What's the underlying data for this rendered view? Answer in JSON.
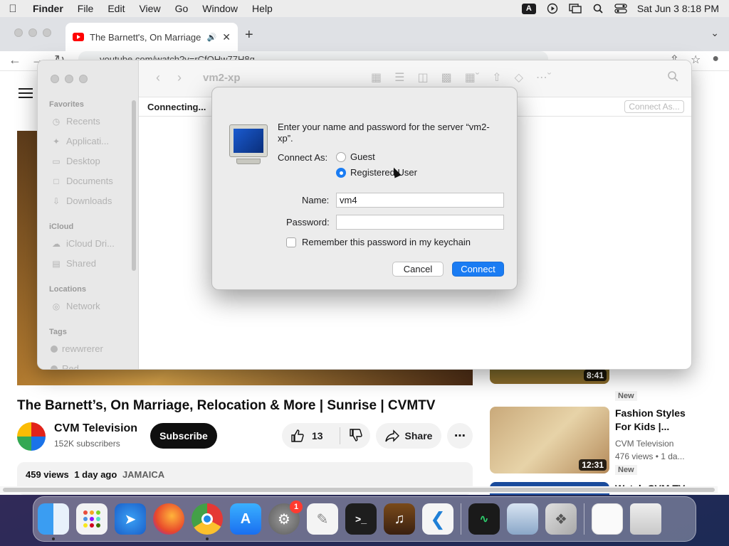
{
  "menubar": {
    "app_name": "Finder",
    "items": [
      "File",
      "Edit",
      "View",
      "Go",
      "Window",
      "Help"
    ],
    "input_source": "A",
    "datetime": "Sat Jun 3  8:18 PM"
  },
  "browser": {
    "tab_title": "The Barnett's, On Marriage",
    "url": "youtube.com/watch?v=rCfQHw77H8g"
  },
  "youtube": {
    "video_title": "The Barnett’s, On Marriage, Relocation & More | Sunrise | CVMTV",
    "channel_name": "CVM Television",
    "channel_subs": "152K subscribers",
    "subscribe_label": "Subscribe",
    "like_count": "13",
    "share_label": "Share",
    "views": "459 views",
    "age": "1 day ago",
    "location": "JAMAICA",
    "recommendations": [
      {
        "duration": "8:41",
        "badge": "New"
      },
      {
        "title": "Fashion Styles For Kids |...",
        "channel": "CVM Television",
        "meta": "476 views  • 1 da...",
        "duration": "12:31",
        "badge": "New"
      },
      {
        "title": "Watch CVM TV: News Rr..."
      }
    ]
  },
  "finder": {
    "title": "vm2-xp",
    "status": "Connecting...",
    "connect_as": "Connect As...",
    "sidebar": {
      "favorites_heading": "Favorites",
      "favorites": [
        "Recents",
        "Applicati...",
        "Desktop",
        "Documents",
        "Downloads"
      ],
      "icloud_heading": "iCloud",
      "icloud": [
        "iCloud Dri...",
        "Shared"
      ],
      "locations_heading": "Locations",
      "locations": [
        "Network"
      ],
      "tags_heading": "Tags",
      "tags": [
        "rewwrerer",
        "Red"
      ]
    }
  },
  "dialog": {
    "prompt": "Enter your name and password for the server “vm2-xp”.",
    "connect_as_label": "Connect As:",
    "guest_label": "Guest",
    "registered_label": "Registered User",
    "selected": "Registered User",
    "name_label": "Name:",
    "name_value": "vm4",
    "password_label": "Password:",
    "password_value": "",
    "remember_label": "Remember this password in my keychain",
    "cancel_label": "Cancel",
    "connect_label": "Connect"
  },
  "dock": {
    "settings_badge": "1"
  },
  "colors": {
    "accent": "#1a7cf3",
    "youtube_red": "#ff0000",
    "badge_red": "#ff3b30"
  }
}
